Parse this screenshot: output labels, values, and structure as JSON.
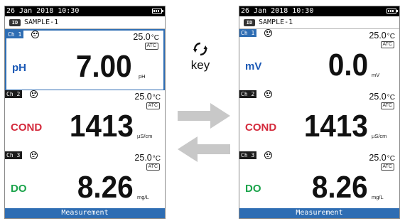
{
  "screens": [
    {
      "status": {
        "datetime": "26 Jan 2018 10:30"
      },
      "sample": {
        "id_badge": "ID",
        "name": "SAMPLE-1"
      },
      "channels": [
        {
          "tab": "Ch 1",
          "param": "pH",
          "param_color": "#1a58b5",
          "temperature": "25.0",
          "temp_unit": "°C",
          "atc": "ATC",
          "value": "7.00",
          "unit": "pH",
          "active": true
        },
        {
          "tab": "Ch 2",
          "param": "COND",
          "param_color": "#d42a3c",
          "temperature": "25.0",
          "temp_unit": "°C",
          "atc": "ATC",
          "value": "1413",
          "unit": "µS/cm",
          "active": false
        },
        {
          "tab": "Ch 3",
          "param": "DO",
          "param_color": "#1aa34a",
          "temperature": "25.0",
          "temp_unit": "°C",
          "atc": "ATC",
          "value": "8.26",
          "unit": "mg/L",
          "active": false
        }
      ],
      "footer": "Measurement"
    },
    {
      "status": {
        "datetime": "26 Jan 2018 10:30"
      },
      "sample": {
        "id_badge": "ID",
        "name": "SAMPLE-1"
      },
      "channels": [
        {
          "tab": "Ch 1",
          "param": "mV",
          "param_color": "#1a58b5",
          "temperature": "25.0",
          "temp_unit": "°C",
          "atc": "ATC",
          "value": "0.0",
          "unit": "mV",
          "active": false
        },
        {
          "tab": "Ch 2",
          "param": "COND",
          "param_color": "#d42a3c",
          "temperature": "25.0",
          "temp_unit": "°C",
          "atc": "ATC",
          "value": "1413",
          "unit": "µS/cm",
          "active": false
        },
        {
          "tab": "Ch 3",
          "param": "DO",
          "param_color": "#1aa34a",
          "temperature": "25.0",
          "temp_unit": "°C",
          "atc": "ATC",
          "value": "8.26",
          "unit": "mg/L",
          "active": false
        }
      ],
      "footer": "Measurement"
    }
  ],
  "key": {
    "label": "key",
    "icon": "refresh-cycle-icon"
  },
  "arrows": {
    "forward": "arrow-right-icon",
    "back": "arrow-left-icon",
    "color": "#c8c8c8"
  },
  "icons": {
    "battery": "battery-icon",
    "smiley": "smiley-icon"
  }
}
